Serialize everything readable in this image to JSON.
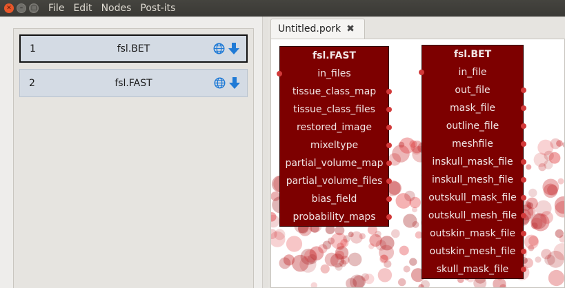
{
  "menubar": {
    "items": [
      "File",
      "Edit",
      "Nodes",
      "Post-its"
    ]
  },
  "node_list": {
    "rows": [
      {
        "index": "1",
        "name": "fsl.BET",
        "selected": true
      },
      {
        "index": "2",
        "name": "fsl.FAST",
        "selected": false
      }
    ]
  },
  "tab": {
    "label": "Untitled.pork",
    "close": "✖"
  },
  "nodes": {
    "fast": {
      "title": "fsl.FAST",
      "inputs": [
        "in_files"
      ],
      "outputs": [
        "tissue_class_map",
        "tissue_class_files",
        "restored_image",
        "mixeltype",
        "partial_volume_map",
        "partial_volume_files",
        "bias_field",
        "probability_maps"
      ]
    },
    "bet": {
      "title": "fsl.BET",
      "inputs": [
        "in_file"
      ],
      "outputs": [
        "out_file",
        "mask_file",
        "outline_file",
        "meshfile",
        "inskull_mask_file",
        "inskull_mesh_file",
        "outskull_mask_file",
        "outskull_mesh_file",
        "outskin_mask_file",
        "outskin_mesh_file",
        "skull_mask_file"
      ]
    }
  },
  "colors": {
    "node_fill": "#7d0000",
    "port": "#d23a3a",
    "accent_blue": "#1f7ad6"
  }
}
